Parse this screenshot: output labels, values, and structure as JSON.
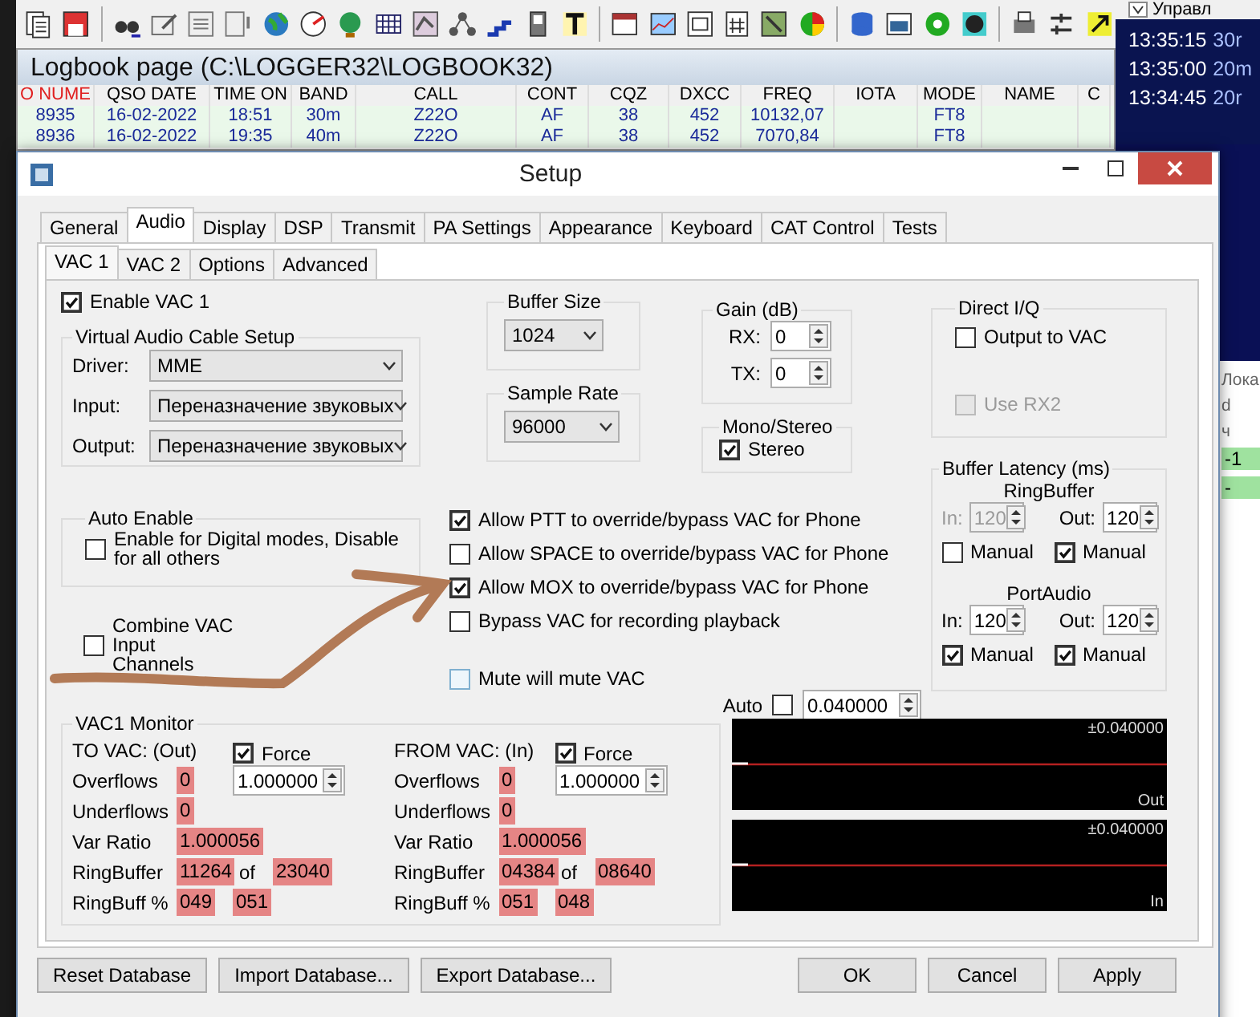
{
  "logbook": {
    "title": "Logbook page (C:\\LOGGER32\\LOGBOOK32)",
    "columns": [
      {
        "label": "O NUME",
        "sorted": true
      },
      {
        "label": "QSO DATE",
        "sorted": false
      },
      {
        "label": "TIME ON",
        "sorted": false
      },
      {
        "label": "BAND",
        "sorted": false
      },
      {
        "label": "CALL",
        "sorted": false
      },
      {
        "label": "CONT",
        "sorted": false
      },
      {
        "label": "CQZ",
        "sorted": false
      },
      {
        "label": "DXCC",
        "sorted": false
      },
      {
        "label": "FREQ",
        "sorted": false
      },
      {
        "label": "IOTA",
        "sorted": false
      },
      {
        "label": "MODE",
        "sorted": false
      },
      {
        "label": "NAME",
        "sorted": false
      },
      {
        "label": "C",
        "sorted": false
      }
    ],
    "rows": [
      [
        "8935",
        "16-02-2022",
        "18:51",
        "30m",
        "Z22O",
        "AF",
        "38",
        "452",
        "10132,07",
        "",
        "FT8",
        "",
        ""
      ],
      [
        "8936",
        "16-02-2022",
        "19:35",
        "40m",
        "Z22O",
        "AF",
        "38",
        "452",
        "7070,84",
        "",
        "FT8",
        "",
        ""
      ]
    ]
  },
  "side_panel": {
    "dropdown": "Управл",
    "times": [
      {
        "time": "13:35:15",
        "band": "30r"
      },
      {
        "time": "13:35:00",
        "band": "20m"
      },
      {
        "time": "13:34:45",
        "band": "20r"
      }
    ],
    "labels": [
      "Лока",
      "d",
      "ч"
    ],
    "highlighted": [
      "-1",
      "-"
    ]
  },
  "setup": {
    "title": "Setup",
    "tabs": [
      {
        "label": "General",
        "selected": false
      },
      {
        "label": "Audio",
        "selected": true
      },
      {
        "label": "Display",
        "selected": false
      },
      {
        "label": "DSP",
        "selected": false
      },
      {
        "label": "Transmit",
        "selected": false
      },
      {
        "label": "PA Settings",
        "selected": false
      },
      {
        "label": "Appearance",
        "selected": false
      },
      {
        "label": "Keyboard",
        "selected": false
      },
      {
        "label": "CAT Control",
        "selected": false
      },
      {
        "label": "Tests",
        "selected": false
      }
    ],
    "subtabs": [
      {
        "label": "VAC 1",
        "selected": true
      },
      {
        "label": "VAC 2",
        "selected": false
      },
      {
        "label": "Options",
        "selected": false
      },
      {
        "label": "Advanced",
        "selected": false
      }
    ],
    "enable_vac": {
      "label": "Enable VAC 1",
      "checked": true
    },
    "vac_setup": {
      "title": "Virtual Audio Cable Setup",
      "fields": [
        {
          "label": "Driver:",
          "value": "MME"
        },
        {
          "label": "Input:",
          "value": "Переназначение звуковых"
        },
        {
          "label": "Output:",
          "value": "Переназначение звуковых"
        }
      ]
    },
    "buffer_size": {
      "title": "Buffer Size",
      "value": "1024"
    },
    "sample_rate": {
      "title": "Sample Rate",
      "value": "96000"
    },
    "gain": {
      "title": "Gain (dB)",
      "fields": [
        {
          "label": "RX:",
          "value": "0"
        },
        {
          "label": "TX:",
          "value": "0"
        }
      ]
    },
    "mono_stereo": {
      "title": "Mono/Stereo",
      "option": {
        "label": "Stereo",
        "checked": true
      }
    },
    "direct_iq": {
      "title": "Direct I/Q",
      "options": [
        {
          "label": "Output to VAC",
          "checked": false,
          "disabled": false
        },
        {
          "label": "Use RX2",
          "checked": false,
          "disabled": true
        }
      ]
    },
    "buffer_latency": {
      "title": "Buffer Latency (ms)",
      "sections": [
        {
          "title": "RingBuffer",
          "fields": [
            {
              "label": "In:",
              "value": "120",
              "disabled": true,
              "manual": {
                "label": "Manual",
                "checked": false
              }
            },
            {
              "label": "Out:",
              "value": "120",
              "disabled": false,
              "manual": {
                "label": "Manual",
                "checked": true
              }
            }
          ]
        },
        {
          "title": "PortAudio",
          "fields": [
            {
              "label": "In:",
              "value": "120",
              "disabled": false,
              "manual": {
                "label": "Manual",
                "checked": true
              }
            },
            {
              "label": "Out:",
              "value": "120",
              "disabled": false,
              "manual": {
                "label": "Manual",
                "checked": true
              }
            }
          ]
        }
      ]
    },
    "auto_enable": {
      "title": "Auto Enable",
      "option": {
        "label": "Enable for Digital modes, Disable for all others",
        "checked": false
      }
    },
    "combine": {
      "label": "Combine VAC Input Channels",
      "checked": false
    },
    "phone_options": [
      {
        "label": "Allow PTT to override/bypass VAC for Phone",
        "checked": true
      },
      {
        "label": "Allow SPACE to override/bypass VAC for Phone",
        "checked": false
      },
      {
        "label": "Allow MOX to override/bypass VAC for Phone",
        "checked": true
      },
      {
        "label": "Bypass VAC for recording playback",
        "checked": false
      }
    ],
    "mute": {
      "label": "Mute will mute VAC",
      "checked": false
    },
    "auto": {
      "label": "Auto",
      "checked": false,
      "value": "0.040000"
    },
    "monitor": {
      "title": "VAC1 Monitor",
      "sides": [
        {
          "heading": "TO VAC: (Out)",
          "force": {
            "label": "Force",
            "checked": true
          },
          "ratio": "1.000000",
          "rows": [
            {
              "label": "Overflows",
              "values": [
                "0"
              ]
            },
            {
              "label": "Underflows",
              "values": [
                "0"
              ]
            },
            {
              "label": "Var Ratio",
              "values": [
                "1.000056"
              ]
            },
            {
              "label": "RingBuffer",
              "values": [
                "11264",
                "23040"
              ],
              "joiner": "of"
            },
            {
              "label": "RingBuff %",
              "values": [
                "049",
                "051"
              ]
            }
          ]
        },
        {
          "heading": "FROM VAC: (In)",
          "force": {
            "label": "Force",
            "checked": true
          },
          "ratio": "1.000000",
          "rows": [
            {
              "label": "Overflows",
              "values": [
                "0"
              ]
            },
            {
              "label": "Underflows",
              "values": [
                "0"
              ]
            },
            {
              "label": "Var Ratio",
              "values": [
                "1.000056"
              ]
            },
            {
              "label": "RingBuffer",
              "values": [
                "04384",
                "08640"
              ],
              "joiner": "of"
            },
            {
              "label": "RingBuff %",
              "values": [
                "051",
                "048"
              ]
            }
          ]
        }
      ]
    },
    "scopes": [
      {
        "range": "±0.040000",
        "label": "Out"
      },
      {
        "range": "±0.040000",
        "label": "In"
      }
    ],
    "buttons_left": [
      "Reset Database",
      "Import Database...",
      "Export Database..."
    ],
    "buttons_right": [
      "OK",
      "Cancel",
      "Apply"
    ]
  }
}
